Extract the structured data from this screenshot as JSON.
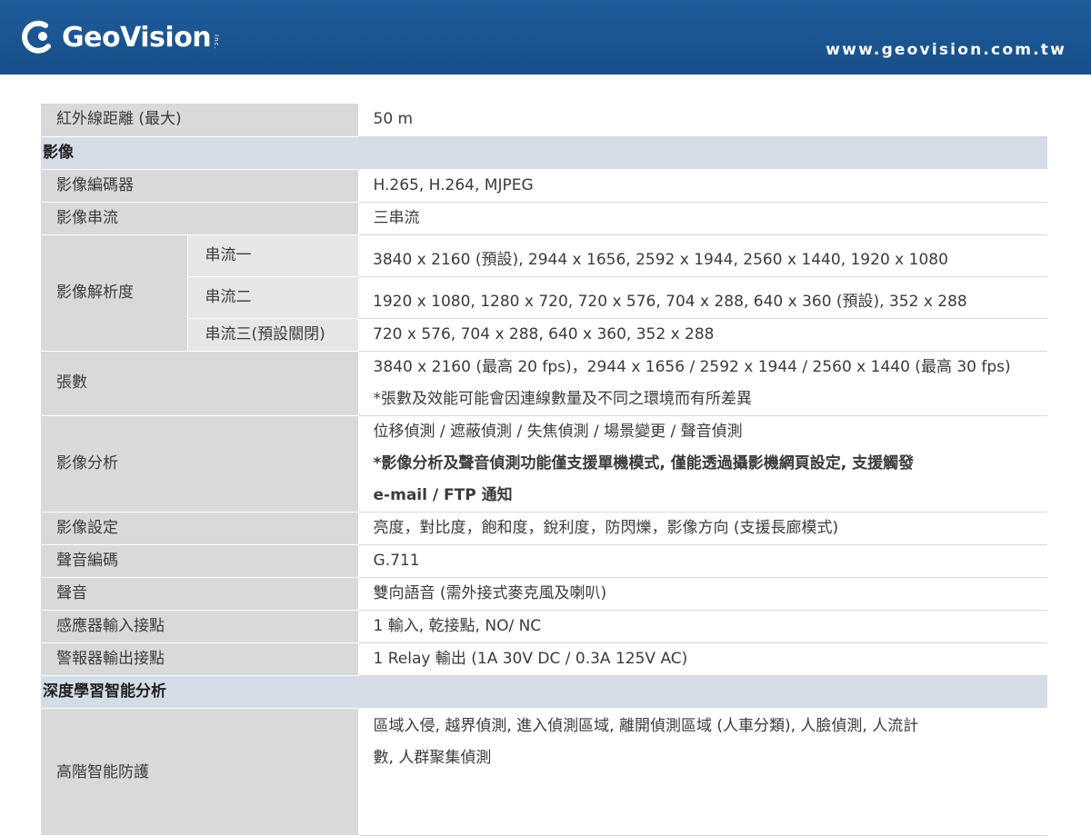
{
  "header": {
    "brand": "GeoVision",
    "brand_suffix": "Inc.",
    "url": "www.geovision.com.tw",
    "colors": {
      "header_bg": "#1f5c9b",
      "label_bg": "#d9d9d9",
      "section_bg": "#d4dce8"
    }
  },
  "rows": {
    "ir_distance": {
      "label": "紅外線距離 (最大)",
      "value": "50 m"
    },
    "section_video": "影像",
    "video_codec": {
      "label": "影像編碼器",
      "value": "H.265, H.264, MJPEG"
    },
    "video_stream": {
      "label": "影像串流",
      "value": "三串流"
    },
    "resolution": {
      "label": "影像解析度",
      "streams": [
        {
          "label": "串流一",
          "value": "3840 x 2160 (預設), 2944 x 1656, 2592 x 1944, 2560 x 1440, 1920 x 1080"
        },
        {
          "label": "串流二",
          "value": "1920 x 1080, 1280 x 720, 720 x 576, 704 x 288, 640 x 360 (預設), 352 x 288"
        },
        {
          "label": "串流三(預設關閉)",
          "value": "720 x 576, 704 x 288, 640 x 360, 352 x 288"
        }
      ]
    },
    "frame_rate": {
      "label": "張數",
      "line1": "3840 x 2160 (最高 20 fps)，2944 x 1656 / 2592 x 1944 / 2560 x 1440 (最高 30 fps)",
      "line2": "*張數及效能可能會因連線數量及不同之環境而有所差異"
    },
    "video_analysis": {
      "label": "影像分析",
      "line1": "位移偵測 / 遮蔽偵測 / 失焦偵測 / 場景變更 / 聲音偵測",
      "line2": "*影像分析及聲音偵測功能僅支援單機模式, 僅能透過攝影機網頁設定, 支援觸發",
      "line3": "e-mail / FTP 通知"
    },
    "video_settings": {
      "label": "影像設定",
      "value": "亮度，對比度，飽和度，銳利度，防閃爍，影像方向 (支援長廊模式)"
    },
    "audio_codec": {
      "label": "聲音編碼",
      "value": "G.711"
    },
    "audio": {
      "label": "聲音",
      "value": "雙向語音 (需外接式麥克風及喇叭)"
    },
    "sensor_input": {
      "label": "感應器輸入接點",
      "value": "1 輸入, 乾接點, NO/ NC"
    },
    "alarm_output": {
      "label": "警報器輸出接點",
      "value": "1 Relay 輸出 (1A 30V DC / 0.3A 125V AC)"
    },
    "section_ai": "深度學習智能分析",
    "advanced_ai": {
      "label": "高階智能防護",
      "line1": "區域入侵, 越界偵測, 進入偵測區域, 離開偵測區域 (人車分類), 人臉偵測, 人流計",
      "line2": "數, 人群聚集偵測"
    }
  }
}
